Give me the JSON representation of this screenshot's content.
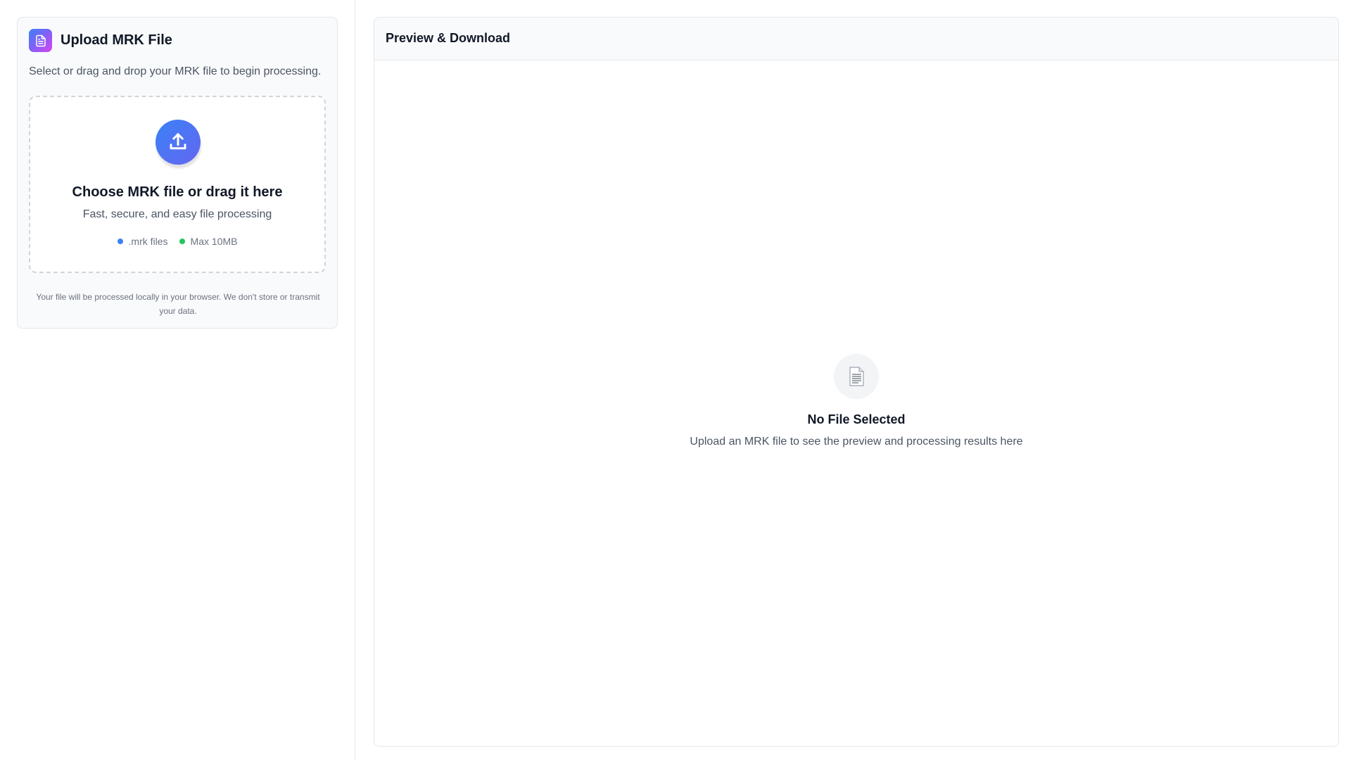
{
  "upload": {
    "icon": "document-icon",
    "title": "Upload MRK File",
    "subtitle": "Select or drag and drop your MRK file to begin processing.",
    "dropzone": {
      "icon": "upload-icon",
      "title": "Choose MRK file or drag it here",
      "subtitle": "Fast, secure, and easy file processing",
      "chips": [
        {
          "label": ".mrk files",
          "color": "#3b82f6"
        },
        {
          "label": "Max 10MB",
          "color": "#22c55e"
        }
      ]
    },
    "privacy_note": "Your file will be processed locally in your browser. We don't store or transmit your data."
  },
  "preview": {
    "title": "Preview & Download",
    "empty": {
      "icon": "file-page-icon",
      "title": "No File Selected",
      "subtitle": "Upload an MRK file to see the preview and processing results here"
    }
  },
  "colors": {
    "accent_blue": "#3b82f6",
    "accent_indigo": "#6366f1",
    "accent_green": "#22c55e",
    "border": "#e5e7eb"
  }
}
